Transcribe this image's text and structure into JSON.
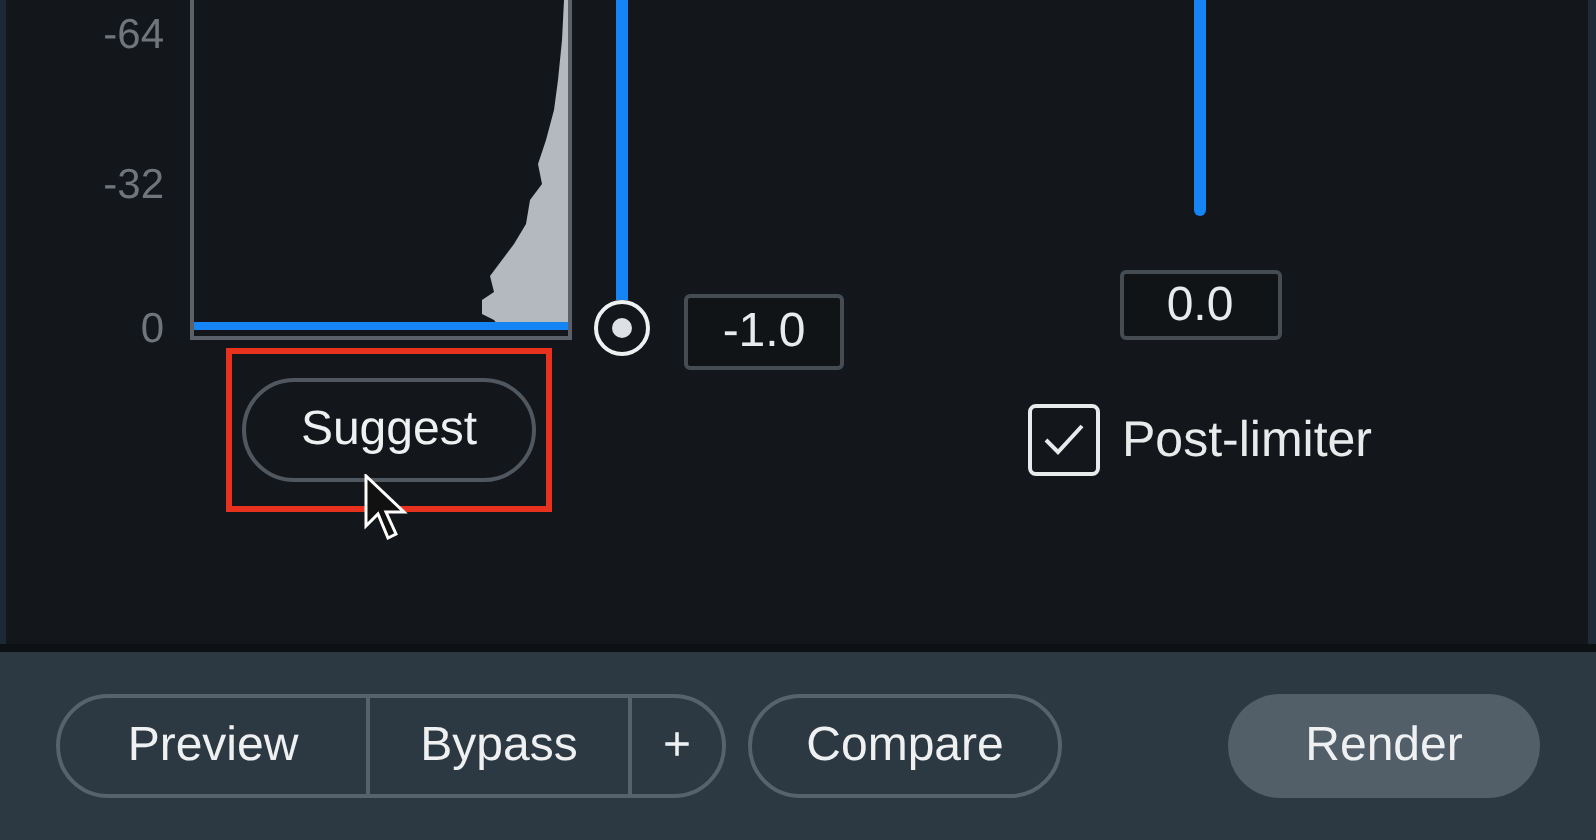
{
  "histogram": {
    "axis_labels": [
      "-64",
      "-32",
      "0"
    ]
  },
  "suggest_button": {
    "label": "Suggest",
    "highlighted": true
  },
  "threshold_slider": {
    "value": "-1.0"
  },
  "output_meter": {
    "value": "0.0"
  },
  "post_limiter": {
    "label": "Post-limiter",
    "checked": true
  },
  "footer": {
    "segments": [
      {
        "label": "Preview"
      },
      {
        "label": "Bypass"
      },
      {
        "label": "+"
      }
    ],
    "compare": "Compare",
    "render": "Render"
  }
}
